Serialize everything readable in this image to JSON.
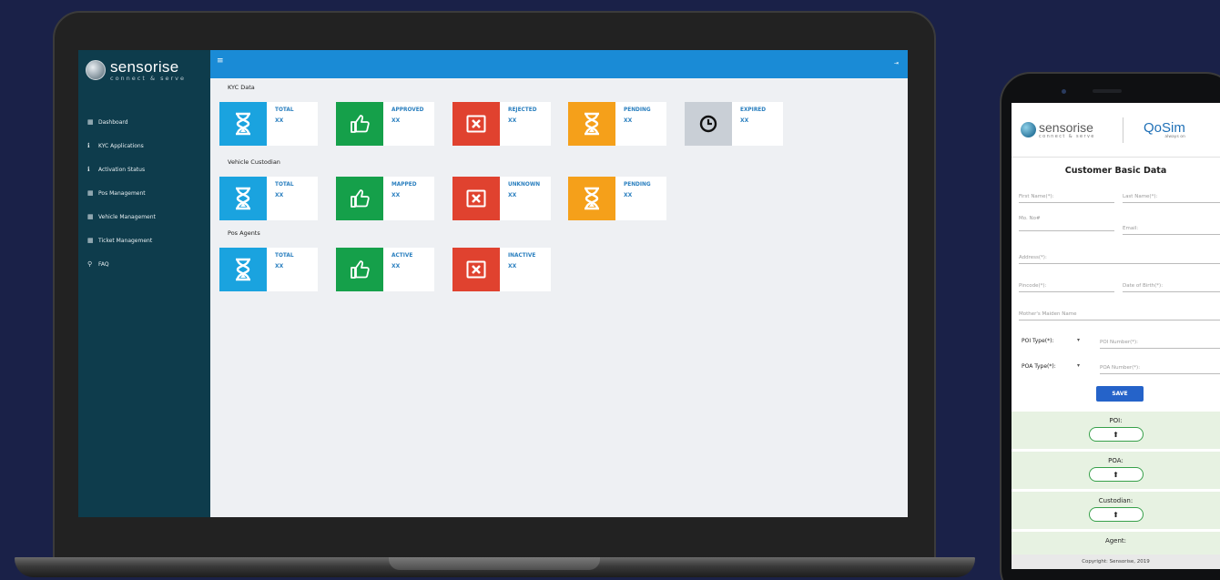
{
  "laptop": {
    "brand": {
      "name": "sensorise",
      "tagline": "connect & serve"
    },
    "sidebar": {
      "items": [
        {
          "label": "Dashboard",
          "icon": "calendar-icon",
          "glyph": "▦"
        },
        {
          "label": "KYC Applications",
          "icon": "info-icon",
          "glyph": "ℹ"
        },
        {
          "label": "Activation Status",
          "icon": "info-icon",
          "glyph": "ℹ"
        },
        {
          "label": "Pos Management",
          "icon": "calendar-icon",
          "glyph": "▦"
        },
        {
          "label": "Vehicle Management",
          "icon": "calendar-icon",
          "glyph": "▦"
        },
        {
          "label": "Ticket Management",
          "icon": "calendar-icon",
          "glyph": "▦"
        },
        {
          "label": "FAQ",
          "icon": "search-icon",
          "glyph": "⚲"
        }
      ]
    },
    "topbar": {
      "menu_glyph": "≡",
      "exit_glyph": "⇥"
    },
    "sections": [
      {
        "title": "KYC Data",
        "cards": [
          {
            "label": "TOTAL",
            "value": "XX",
            "icon": "hourglass-icon",
            "color": "#1aa3df"
          },
          {
            "label": "APPROVED",
            "value": "XX",
            "icon": "thumbs-up-icon",
            "color": "#15a04a"
          },
          {
            "label": "REJECTED",
            "value": "XX",
            "icon": "close-box-icon",
            "color": "#e0422f"
          },
          {
            "label": "PENDING",
            "value": "XX",
            "icon": "hourglass-icon",
            "color": "#f5a01a"
          },
          {
            "label": "EXPIRED",
            "value": "XX",
            "icon": "clock-icon",
            "color": "#c9cfd6"
          }
        ]
      },
      {
        "title": "Vehicle Custodian",
        "cards": [
          {
            "label": "TOTAL",
            "value": "XX",
            "icon": "hourglass-icon",
            "color": "#1aa3df"
          },
          {
            "label": "MAPPED",
            "value": "XX",
            "icon": "thumbs-up-icon",
            "color": "#15a04a"
          },
          {
            "label": "UNKNOWN",
            "value": "XX",
            "icon": "close-box-icon",
            "color": "#e0422f"
          },
          {
            "label": "PENDING",
            "value": "XX",
            "icon": "hourglass-icon",
            "color": "#f5a01a"
          }
        ]
      },
      {
        "title": "Pos Agents",
        "cards": [
          {
            "label": "TOTAL",
            "value": "XX",
            "icon": "hourglass-icon",
            "color": "#1aa3df"
          },
          {
            "label": "ACTIVE",
            "value": "XX",
            "icon": "thumbs-up-icon",
            "color": "#15a04a"
          },
          {
            "label": "INACTIVE",
            "value": "XX",
            "icon": "close-box-icon",
            "color": "#e0422f"
          }
        ]
      }
    ]
  },
  "phone": {
    "logo_left": {
      "name": "sensorise",
      "tagline": "connect & serve"
    },
    "logo_right": {
      "name": "QoSim",
      "tagline": "always on"
    },
    "title": "Customer Basic Data",
    "fields": {
      "first_name": "First Name(*):",
      "last_name": "Last Name(*):",
      "mobile": "Mo. No#",
      "email": "Email:",
      "address": "Address(*):",
      "pincode": "Pincode(*):",
      "dob": "Date of Birth(*):",
      "mothers_maiden": "Mother's Maiden Name",
      "poi_type": "POI Type(*):",
      "poi_number": "POI Number(*):",
      "poa_type": "POA Type(*):",
      "poa_number": "POA Number(*):"
    },
    "save_label": "SAVE",
    "uploads": [
      {
        "label": "POI:",
        "glyph": "⬆"
      },
      {
        "label": "POA:",
        "glyph": "⬆"
      },
      {
        "label": "Custodian:",
        "glyph": "⬆"
      },
      {
        "label": "Agent:",
        "glyph": "⬆"
      }
    ],
    "footer": "Copyright: Sensorise, 2019"
  }
}
